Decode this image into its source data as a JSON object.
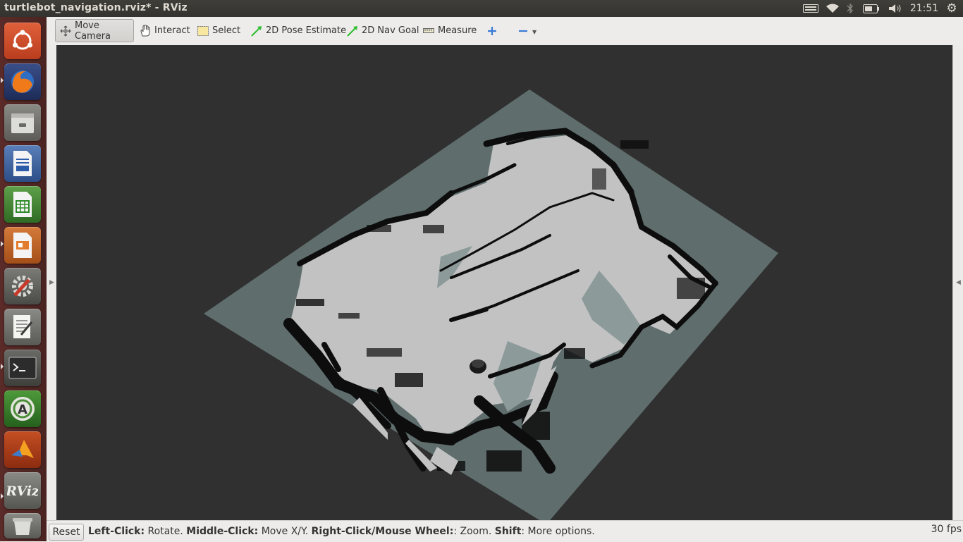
{
  "window": {
    "title": "turtlebot_navigation.rviz* - RViz"
  },
  "tray": {
    "clock": "21:51"
  },
  "toolbar": {
    "move_camera": "Move Camera",
    "interact": "Interact",
    "select": "Select",
    "pose_estimate": "2D Pose Estimate",
    "nav_goal": "2D Nav Goal",
    "measure": "Measure"
  },
  "launcher": {
    "items": [
      "ubuntu-dash-icon",
      "firefox-icon",
      "files-icon",
      "writer-icon",
      "calc-icon",
      "impress-icon",
      "system-settings-icon",
      "text-editor-icon",
      "terminal-icon",
      "software-updater-icon",
      "matlab-icon",
      "rviz-icon",
      "trash-icon"
    ]
  },
  "status": {
    "reset": "Reset",
    "left_click_label": "Left-Click:",
    "left_click_action": " Rotate. ",
    "middle_click_label": "Middle-Click:",
    "middle_click_action": " Move X/Y. ",
    "right_click_label": "Right-Click/Mouse Wheel:",
    "right_click_action": ": Zoom. ",
    "shift_label": "Shift",
    "shift_action": ": More options.",
    "fps": "30 fps"
  },
  "colors": {
    "viewport_bg": "#303030",
    "grid_plane": "#5f6d6d",
    "free_space": "#c2c2c2",
    "obstacles": "#0d0d0d",
    "launcher": "#4f2623"
  }
}
